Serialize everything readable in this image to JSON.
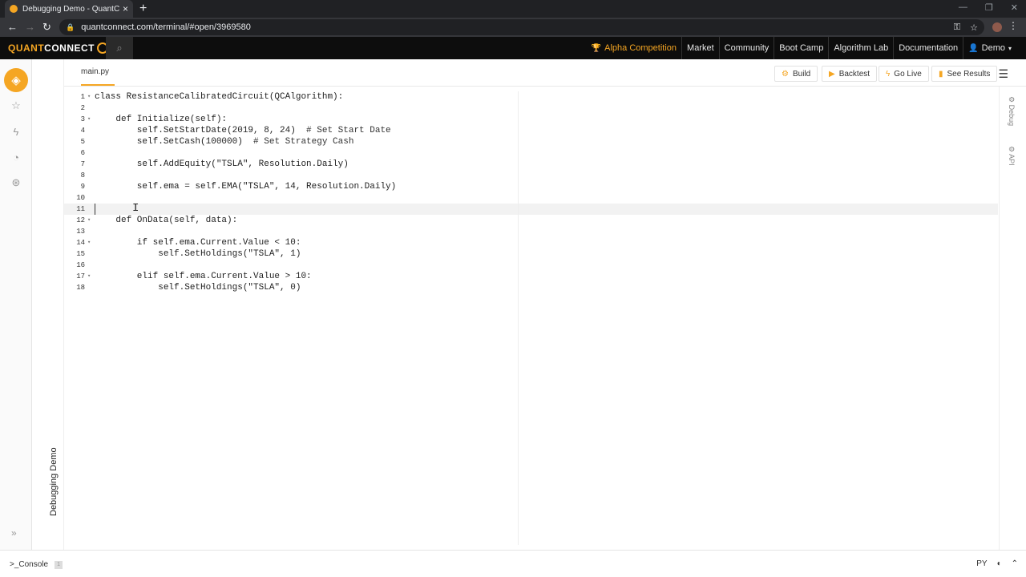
{
  "browser": {
    "tab_title": "Debugging Demo - QuantConn",
    "url": "quantconnect.com/terminal/#open/3969580"
  },
  "header": {
    "logo_part1": "QUANT",
    "logo_part2": "CONNECT",
    "nav": [
      {
        "label": "Alpha Competition",
        "icon": "trophy-icon"
      },
      {
        "label": "Market"
      },
      {
        "label": "Community"
      },
      {
        "label": "Boot Camp"
      },
      {
        "label": "Algorithm Lab"
      },
      {
        "label": "Documentation"
      },
      {
        "label": "Demo",
        "icon": "user-icon"
      }
    ]
  },
  "project": {
    "name": "Debugging Demo"
  },
  "editor": {
    "file_tab": "main.py",
    "toolbar": [
      {
        "label": "Build",
        "icon": "gears-icon"
      },
      {
        "label": "Backtest",
        "icon": "play-icon"
      },
      {
        "label": "Go Live",
        "icon": "bolt-icon"
      },
      {
        "label": "See Results",
        "icon": "bars-icon"
      }
    ],
    "lines": [
      "1",
      "2",
      "3",
      "4",
      "5",
      "6",
      "7",
      "8",
      "9",
      "10",
      "11",
      "12",
      "13",
      "14",
      "15",
      "16",
      "17",
      "18"
    ],
    "code": {
      "l1": "class ResistanceCalibratedCircuit(QCAlgorithm):",
      "l3": "    def Initialize(self):",
      "l4a": "        self.SetStartDate(2019, 8, 24)",
      "l4b": "  # Set Start Date",
      "l5a": "        self.SetCash(100000)",
      "l5b": "  # Set Strategy Cash",
      "l7": "        self.AddEquity(\"TSLA\", Resolution.Daily)",
      "l9": "        self.ema = self.EMA(\"TSLA\", 14, Resolution.Daily)",
      "l12": "    def OnData(self, data):",
      "l14": "        if self.ema.Current.Value < 10:",
      "l15": "            self.SetHoldings(\"TSLA\", 1)",
      "l17": "        elif self.ema.Current.Value > 10:",
      "l18": "            self.SetHoldings(\"TSLA\", 0)"
    }
  },
  "right_tabs": [
    "Debug",
    "API"
  ],
  "bottom": {
    "console": ">_Console",
    "console_count": "1",
    "language": "PY"
  }
}
